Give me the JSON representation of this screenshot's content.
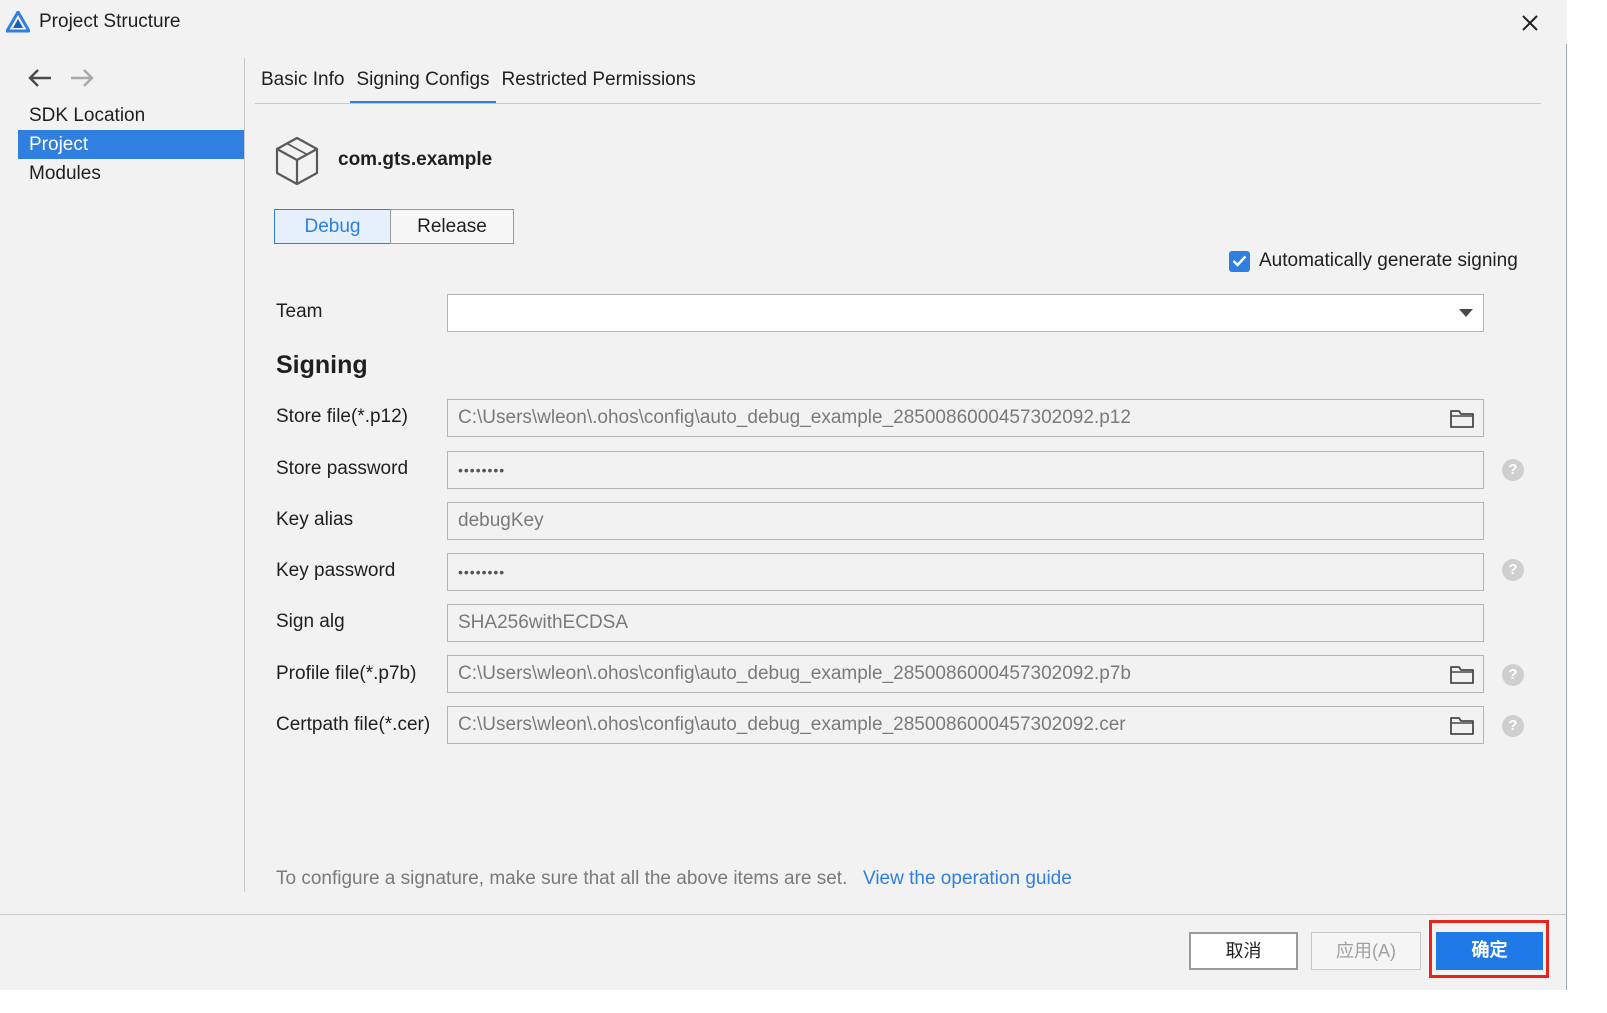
{
  "window": {
    "title": "Project Structure"
  },
  "sidebar": {
    "items": [
      {
        "label": "SDK Location"
      },
      {
        "label": "Project"
      },
      {
        "label": "Modules"
      }
    ],
    "active_index": 1
  },
  "tabs": [
    {
      "label": "Basic Info"
    },
    {
      "label": "Signing Configs"
    },
    {
      "label": "Restricted Permissions"
    }
  ],
  "module": {
    "name": "com.gts.example"
  },
  "build_type": {
    "debug_label": "Debug",
    "release_label": "Release",
    "selected": "Debug"
  },
  "auto_sign": {
    "label": "Automatically generate signing",
    "checked": true
  },
  "team": {
    "label": "Team",
    "value": ""
  },
  "signing": {
    "title": "Signing",
    "fields": {
      "store_file": {
        "label": "Store file(*.p12)",
        "value": "C:\\Users\\wleon\\.ohos\\config\\auto_debug_example_2850086000457302092.p12"
      },
      "store_password": {
        "label": "Store password",
        "value": "••••••••"
      },
      "key_alias": {
        "label": "Key alias",
        "value": "debugKey"
      },
      "key_password": {
        "label": "Key password",
        "value": "••••••••"
      },
      "sign_alg": {
        "label": "Sign alg",
        "value": "SHA256withECDSA"
      },
      "profile_file": {
        "label": "Profile file(*.p7b)",
        "value": "C:\\Users\\wleon\\.ohos\\config\\auto_debug_example_2850086000457302092.p7b"
      },
      "certpath_file": {
        "label": "Certpath file(*.cer)",
        "value": "C:\\Users\\wleon\\.ohos\\config\\auto_debug_example_2850086000457302092.cer"
      }
    }
  },
  "footer": {
    "note": "To configure a signature, make sure that all the above items are set.",
    "link": "View the operation guide"
  },
  "buttons": {
    "cancel": "取消",
    "apply": "应用(A)",
    "ok": "确定"
  },
  "colors": {
    "accent": "#2f7fe0",
    "highlight": "#e6241b"
  }
}
